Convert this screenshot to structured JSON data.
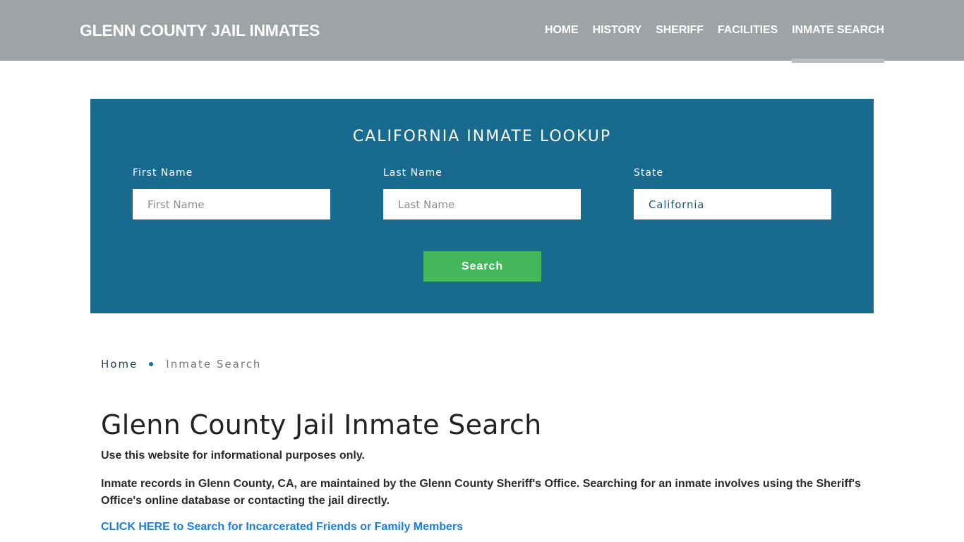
{
  "header": {
    "brand": "GLENN COUNTY JAIL INMATES",
    "nav": [
      {
        "label": "HOME",
        "active": false
      },
      {
        "label": "HISTORY",
        "active": false
      },
      {
        "label": "SHERIFF",
        "active": false
      },
      {
        "label": "FACILITIES",
        "active": false
      },
      {
        "label": "INMATE SEARCH",
        "active": true
      }
    ]
  },
  "lookup": {
    "title": "CALIFORNIA INMATE LOOKUP",
    "fields": {
      "first_name": {
        "label": "First Name",
        "placeholder": "First Name",
        "value": ""
      },
      "last_name": {
        "label": "Last Name",
        "placeholder": "Last Name",
        "value": ""
      },
      "state": {
        "label": "State",
        "value": "California"
      }
    },
    "search_label": "Search"
  },
  "breadcrumb": {
    "home": "Home",
    "current": "Inmate Search"
  },
  "main": {
    "title": "Glenn County Jail Inmate Search",
    "paragraphs": [
      "Use this website for informational purposes only.",
      "Inmate records in Glenn County, CA, are maintained by the Glenn County Sheriff's Office. Searching for an inmate involves using the Sheriff's Office's online database or contacting the jail directly."
    ],
    "cta": "CLICK HERE to Search for Incarcerated Friends or Family Members"
  },
  "colors": {
    "header_bg": "#9ea3a6",
    "lookup_bg": "#186b8e",
    "search_button": "#43b85a",
    "link": "#1a7fe0"
  }
}
